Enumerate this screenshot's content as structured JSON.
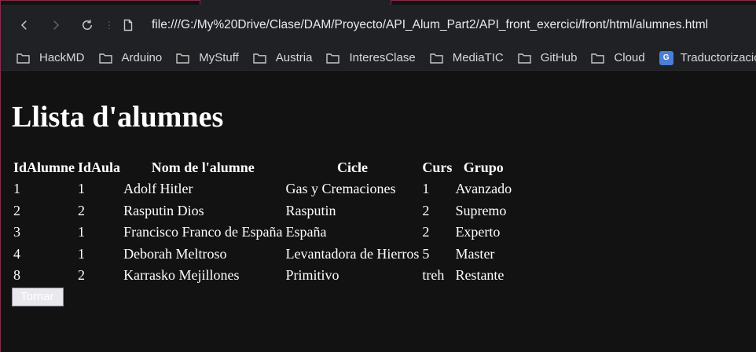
{
  "browser": {
    "url": "file:///G:/My%20Drive/Clase/DAM/Proyecto/API_Alum_Part2/API_front_exercici/front/html/alumnes.html",
    "bookmarks": [
      "HackMD",
      "Arduino",
      "MyStuff",
      "Austria",
      "InteresClase",
      "MediaTIC",
      "GitHub",
      "Cloud",
      "Traductorizacion"
    ]
  },
  "page": {
    "title": "Llista d'alumnes",
    "table": {
      "headers": [
        "IdAlumne",
        "IdAula",
        "Nom de l'alumne",
        "Cicle",
        "Curs",
        "Grupo"
      ],
      "rows": [
        [
          "1",
          "1",
          "Adolf Hitler",
          "Gas y Cremaciones",
          "1",
          "Avanzado"
        ],
        [
          "2",
          "2",
          "Rasputin Dios",
          "Rasputin",
          "2",
          "Supremo"
        ],
        [
          "3",
          "1",
          "Francisco Franco de España",
          "España",
          "2",
          "Experto"
        ],
        [
          "4",
          "1",
          "Deborah Meltroso",
          "Levantadora de Hierros",
          "5",
          "Master"
        ],
        [
          "8",
          "2",
          "Karrasko Mejillones",
          "Primitivo",
          "treh",
          "Restante"
        ]
      ]
    },
    "back_button_label": "Tornar"
  },
  "colors": {
    "background": "#121213",
    "browser_chrome": "#202124",
    "frame_accent": "#8a2a4a"
  }
}
